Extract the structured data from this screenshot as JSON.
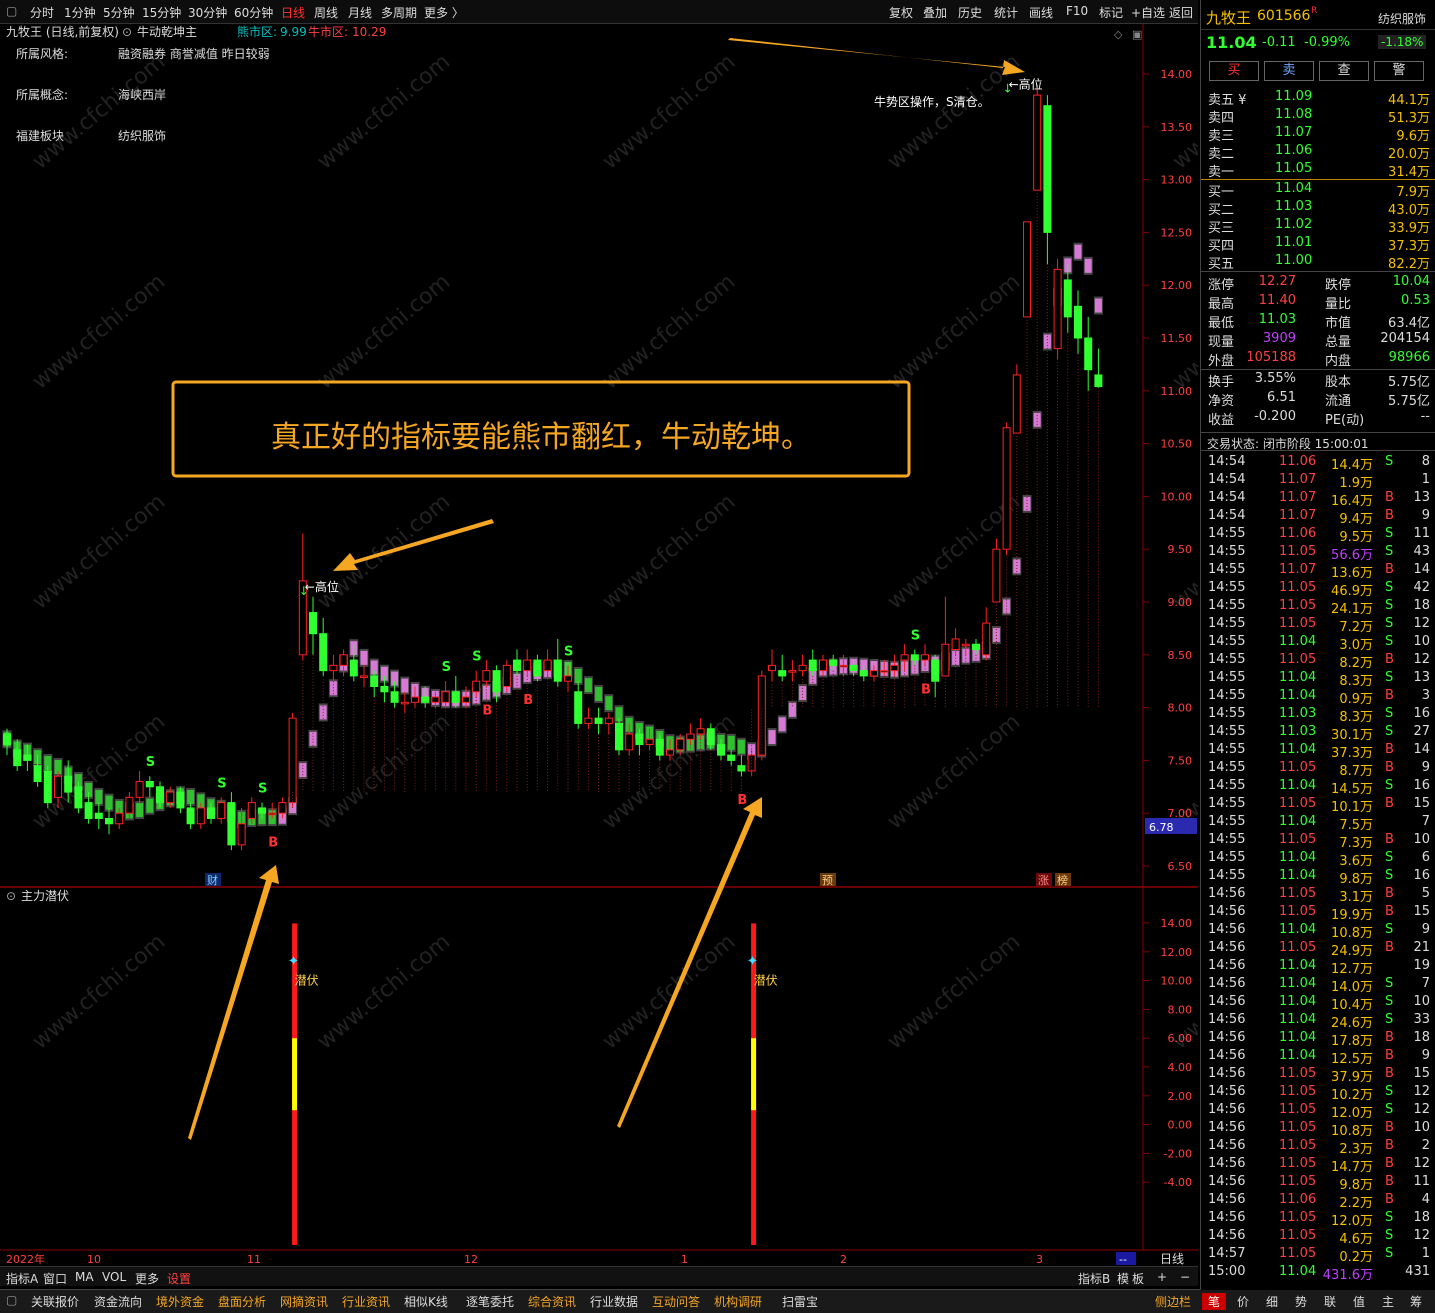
{
  "toolbar": {
    "items": [
      "分时",
      "1分钟",
      "5分钟",
      "15分钟",
      "30分钟",
      "60分钟",
      "日线",
      "周线",
      "月线",
      "多周期",
      "更多 〉"
    ],
    "right": [
      "复权",
      "叠加",
      "历史",
      "统计",
      "画线",
      "F10",
      "标记",
      "+自选",
      "返回"
    ]
  },
  "chart_header": {
    "title": "九牧王 (日线,前复权)",
    "indicator": "牛动乾坤主",
    "bear_label": "熊市区:",
    "bear_value": "9.99",
    "bull_label": "牛市区:",
    "bull_value": "10.29"
  },
  "info": [
    {
      "k": "所属风格:",
      "v": "融资融券 商誉减值 昨日较弱"
    },
    {
      "k": "所属概念:",
      "v": "海峡西岸"
    },
    {
      "k": "福建板块",
      "v": "纺织服饰"
    }
  ],
  "annotations": {
    "headline": "真正好的指标要能熊市翻红，牛动乾坤。",
    "note": "牛势区操作，S清仓。",
    "high": "←高位",
    "lurk": "潜伏",
    "current_price_tag": "6.78",
    "event_cai": "财",
    "event_yu": "预",
    "event_zhang": "涨",
    "event_bang": "榜"
  },
  "sub_panel_title": "主力潜伏",
  "x_axis": {
    "labels": [
      "2022年",
      "10",
      "11",
      "12",
      "1",
      "2",
      "3"
    ],
    "period": "日线",
    "dash": "--"
  },
  "bottom_bar1": [
    "指标A",
    "窗口",
    "MA",
    "VOL",
    "更多",
    "设置"
  ],
  "bottom_bar1_right": [
    "指标B",
    "模",
    "板",
    "+",
    "−"
  ],
  "bottom_bar2": [
    "关联报价",
    "资金流向",
    "境外资金",
    "盘面分析",
    "网摘资讯",
    "行业资讯",
    "相似K线",
    "逐笔委托",
    "综合资讯",
    "行业数据",
    "互动问答",
    "机构调研",
    "扫雷宝"
  ],
  "bottom_bar2_right": [
    "侧边栏",
    "笔",
    "价",
    "细",
    "势",
    "联",
    "值",
    "主",
    "筹"
  ],
  "quote": {
    "name": "九牧王",
    "code": "601566",
    "r_badge": "R",
    "sector": "纺织服饰",
    "price": "11.04",
    "change": "-0.11",
    "pct": "-0.99%",
    "sector_pct": "-1.18%",
    "buttons": [
      "买",
      "卖",
      "查",
      "警"
    ]
  },
  "orderbook": {
    "sell": [
      {
        "l": "卖五 ¥",
        "p": "11.09",
        "v": "44.1万"
      },
      {
        "l": "卖四",
        "p": "11.08",
        "v": "51.3万"
      },
      {
        "l": "卖三",
        "p": "11.07",
        "v": "9.6万"
      },
      {
        "l": "卖二",
        "p": "11.06",
        "v": "20.0万"
      },
      {
        "l": "卖一",
        "p": "11.05",
        "v": "31.4万"
      }
    ],
    "buy": [
      {
        "l": "买一",
        "p": "11.04",
        "v": "7.9万"
      },
      {
        "l": "买二",
        "p": "11.03",
        "v": "43.0万"
      },
      {
        "l": "买三",
        "p": "11.02",
        "v": "33.9万"
      },
      {
        "l": "买四",
        "p": "11.01",
        "v": "37.3万"
      },
      {
        "l": "买五",
        "p": "11.00",
        "v": "82.2万"
      }
    ]
  },
  "stats": [
    [
      "涨停",
      "12.27",
      "跌停",
      "10.04"
    ],
    [
      "最高",
      "11.40",
      "量比",
      "0.53"
    ],
    [
      "最低",
      "11.03",
      "市值",
      "63.4亿"
    ],
    [
      "现量",
      "3909",
      "总量",
      "204154"
    ],
    [
      "外盘",
      "105188",
      "内盘",
      "98966"
    ],
    [
      "换手",
      "3.55%",
      "股本",
      "5.75亿"
    ],
    [
      "净资",
      "6.51",
      "流通",
      "5.75亿"
    ],
    [
      "收益",
      "-0.200",
      "PE(动)",
      "--"
    ]
  ],
  "trade_status": "交易状态: 闭市阶段 15:00:01",
  "ticks": [
    [
      "14:54",
      "11.06",
      "14.4万",
      "S",
      "8"
    ],
    [
      "14:54",
      "11.07",
      "1.9万",
      "",
      "1"
    ],
    [
      "14:54",
      "11.07",
      "16.4万",
      "B",
      "13"
    ],
    [
      "14:54",
      "11.07",
      "9.4万",
      "B",
      "9"
    ],
    [
      "14:55",
      "11.06",
      "9.5万",
      "S",
      "11"
    ],
    [
      "14:55",
      "11.05",
      "56.6万",
      "S",
      "43"
    ],
    [
      "14:55",
      "11.07",
      "13.6万",
      "B",
      "14"
    ],
    [
      "14:55",
      "11.05",
      "46.9万",
      "S",
      "42"
    ],
    [
      "14:55",
      "11.05",
      "24.1万",
      "S",
      "18"
    ],
    [
      "14:55",
      "11.05",
      "7.2万",
      "S",
      "12"
    ],
    [
      "14:55",
      "11.04",
      "3.0万",
      "S",
      "10"
    ],
    [
      "14:55",
      "11.05",
      "8.2万",
      "B",
      "12"
    ],
    [
      "14:55",
      "11.04",
      "8.3万",
      "S",
      "13"
    ],
    [
      "14:55",
      "11.04",
      "0.9万",
      "B",
      "3"
    ],
    [
      "14:55",
      "11.03",
      "8.3万",
      "S",
      "16"
    ],
    [
      "14:55",
      "11.03",
      "30.1万",
      "S",
      "27"
    ],
    [
      "14:55",
      "11.04",
      "37.3万",
      "B",
      "14"
    ],
    [
      "14:55",
      "11.05",
      "8.7万",
      "B",
      "9"
    ],
    [
      "14:55",
      "11.04",
      "14.5万",
      "S",
      "16"
    ],
    [
      "14:55",
      "11.05",
      "10.1万",
      "B",
      "15"
    ],
    [
      "14:55",
      "11.04",
      "7.5万",
      "",
      "7"
    ],
    [
      "14:55",
      "11.05",
      "7.3万",
      "B",
      "10"
    ],
    [
      "14:55",
      "11.04",
      "3.6万",
      "S",
      "6"
    ],
    [
      "14:55",
      "11.04",
      "9.8万",
      "S",
      "16"
    ],
    [
      "14:56",
      "11.05",
      "3.1万",
      "B",
      "5"
    ],
    [
      "14:56",
      "11.05",
      "19.9万",
      "B",
      "15"
    ],
    [
      "14:56",
      "11.04",
      "10.8万",
      "S",
      "9"
    ],
    [
      "14:56",
      "11.05",
      "24.9万",
      "B",
      "21"
    ],
    [
      "14:56",
      "11.04",
      "12.7万",
      "",
      "19"
    ],
    [
      "14:56",
      "11.04",
      "14.0万",
      "S",
      "7"
    ],
    [
      "14:56",
      "11.04",
      "10.4万",
      "S",
      "10"
    ],
    [
      "14:56",
      "11.04",
      "24.6万",
      "S",
      "33"
    ],
    [
      "14:56",
      "11.04",
      "17.8万",
      "B",
      "18"
    ],
    [
      "14:56",
      "11.04",
      "12.5万",
      "B",
      "9"
    ],
    [
      "14:56",
      "11.05",
      "37.9万",
      "B",
      "15"
    ],
    [
      "14:56",
      "11.05",
      "10.2万",
      "S",
      "12"
    ],
    [
      "14:56",
      "11.05",
      "12.0万",
      "S",
      "12"
    ],
    [
      "14:56",
      "11.05",
      "10.8万",
      "B",
      "10"
    ],
    [
      "14:56",
      "11.05",
      "2.3万",
      "B",
      "2"
    ],
    [
      "14:56",
      "11.05",
      "14.7万",
      "B",
      "12"
    ],
    [
      "14:56",
      "11.05",
      "9.8万",
      "B",
      "11"
    ],
    [
      "14:56",
      "11.06",
      "2.2万",
      "B",
      "4"
    ],
    [
      "14:56",
      "11.05",
      "12.0万",
      "S",
      "18"
    ],
    [
      "14:56",
      "11.05",
      "4.6万",
      "S",
      "12"
    ],
    [
      "14:57",
      "11.05",
      "0.2万",
      "S",
      "1"
    ],
    [
      "15:00",
      "11.04",
      "431.6万",
      "",
      "431"
    ]
  ],
  "chart_data": {
    "type": "candlestick",
    "y_ticks": [
      "14.00",
      "13.50",
      "13.00",
      "12.50",
      "12.00",
      "11.50",
      "11.00",
      "10.50",
      "10.00",
      "9.50",
      "9.00",
      "8.50",
      "8.00",
      "7.50",
      "7.00",
      "6.50"
    ],
    "ylim": [
      6.3,
      14.3
    ],
    "sub_y_ticks": [
      "14.00",
      "12.00",
      "10.00",
      "8.00",
      "6.00",
      "4.00",
      "2.00",
      "0.00",
      "-2.00",
      "-4.00"
    ],
    "sub_ylim": [
      -6.0,
      15.0
    ],
    "high_marks": [
      {
        "i": 29,
        "price": 9.14
      },
      {
        "i": 98,
        "price": 13.9
      }
    ],
    "signals": [
      {
        "i": 14,
        "t": "S"
      },
      {
        "i": 21,
        "t": "S"
      },
      {
        "i": 25,
        "t": "S"
      },
      {
        "i": 26,
        "t": "B"
      },
      {
        "i": 43,
        "t": "S"
      },
      {
        "i": 46,
        "t": "S"
      },
      {
        "i": 47,
        "t": "B"
      },
      {
        "i": 51,
        "t": "B"
      },
      {
        "i": 55,
        "t": "S"
      },
      {
        "i": 72,
        "t": "B"
      },
      {
        "i": 89,
        "t": "S"
      },
      {
        "i": 90,
        "t": "B"
      }
    ],
    "lurk_signals": [
      {
        "i": 28,
        "value": 13.0
      },
      {
        "i": 73,
        "value": 13.0
      }
    ],
    "candles": [
      [
        7.75,
        7.65,
        7.8,
        7.55
      ],
      [
        7.6,
        7.45,
        7.7,
        7.4
      ],
      [
        7.55,
        7.5,
        7.65,
        7.4
      ],
      [
        7.45,
        7.3,
        7.55,
        7.25
      ],
      [
        7.4,
        7.1,
        7.45,
        7.05
      ],
      [
        7.15,
        7.35,
        7.4,
        7.05
      ],
      [
        7.35,
        7.2,
        7.5,
        7.1
      ],
      [
        7.25,
        7.05,
        7.3,
        7.0
      ],
      [
        7.1,
        6.95,
        7.2,
        6.9
      ],
      [
        7.0,
        6.95,
        7.1,
        6.85
      ],
      [
        6.95,
        6.9,
        7.05,
        6.8
      ],
      [
        6.9,
        7.0,
        7.05,
        6.85
      ],
      [
        7.0,
        7.15,
        7.2,
        6.95
      ],
      [
        7.15,
        7.3,
        7.4,
        7.1
      ],
      [
        7.3,
        7.25,
        7.35,
        7.15
      ],
      [
        7.25,
        7.1,
        7.3,
        7.05
      ],
      [
        7.1,
        7.2,
        7.25,
        7.05
      ],
      [
        7.2,
        7.05,
        7.25,
        7.0
      ],
      [
        7.05,
        6.9,
        7.1,
        6.85
      ],
      [
        6.9,
        7.05,
        7.1,
        6.85
      ],
      [
        7.05,
        6.95,
        7.1,
        6.9
      ],
      [
        6.95,
        7.1,
        7.15,
        6.9
      ],
      [
        7.1,
        6.7,
        7.2,
        6.65
      ],
      [
        6.7,
        6.9,
        7.05,
        6.65
      ],
      [
        6.95,
        7.1,
        7.15,
        6.9
      ],
      [
        7.05,
        7.0,
        7.1,
        6.95
      ],
      [
        7.0,
        7.0,
        7.1,
        6.95
      ],
      [
        7.0,
        7.1,
        7.15,
        6.95
      ],
      [
        7.1,
        7.9,
        7.95,
        7.05
      ],
      [
        8.5,
        9.2,
        9.65,
        8.45
      ],
      [
        8.9,
        8.7,
        9.05,
        8.5
      ],
      [
        8.7,
        8.35,
        8.85,
        8.3
      ],
      [
        8.35,
        8.4,
        8.5,
        8.25
      ],
      [
        8.4,
        8.5,
        8.55,
        8.3
      ],
      [
        8.45,
        8.3,
        8.6,
        8.25
      ],
      [
        8.3,
        8.3,
        8.4,
        8.2
      ],
      [
        8.3,
        8.2,
        8.35,
        8.1
      ],
      [
        8.2,
        8.15,
        8.3,
        8.05
      ],
      [
        8.15,
        8.05,
        8.25,
        8.0
      ],
      [
        8.05,
        8.05,
        8.15,
        7.95
      ],
      [
        8.05,
        8.1,
        8.2,
        8.0
      ],
      [
        8.1,
        8.05,
        8.2,
        8.0
      ],
      [
        8.05,
        8.1,
        8.15,
        8.0
      ],
      [
        8.05,
        8.15,
        8.25,
        8.0
      ],
      [
        8.15,
        8.05,
        8.3,
        8.0
      ],
      [
        8.05,
        8.1,
        8.2,
        8.0
      ],
      [
        8.15,
        8.25,
        8.35,
        8.1
      ],
      [
        8.25,
        8.35,
        8.45,
        8.2
      ],
      [
        8.35,
        8.15,
        8.4,
        8.05
      ],
      [
        8.2,
        8.4,
        8.45,
        8.15
      ],
      [
        8.45,
        8.35,
        8.55,
        8.3
      ],
      [
        8.35,
        8.45,
        8.55,
        8.3
      ],
      [
        8.45,
        8.3,
        8.5,
        8.25
      ],
      [
        8.35,
        8.45,
        8.55,
        8.3
      ],
      [
        8.45,
        8.25,
        8.65,
        8.2
      ],
      [
        8.25,
        8.3,
        8.4,
        8.15
      ],
      [
        8.15,
        7.85,
        8.25,
        7.8
      ],
      [
        7.85,
        7.9,
        8.0,
        7.8
      ],
      [
        7.9,
        7.85,
        8.0,
        7.75
      ],
      [
        7.85,
        7.9,
        7.95,
        7.75
      ],
      [
        7.85,
        7.6,
        7.9,
        7.55
      ],
      [
        7.6,
        7.75,
        7.85,
        7.55
      ],
      [
        7.75,
        7.65,
        7.8,
        7.55
      ],
      [
        7.65,
        7.7,
        7.8,
        7.6
      ],
      [
        7.7,
        7.55,
        7.75,
        7.5
      ],
      [
        7.55,
        7.6,
        7.7,
        7.5
      ],
      [
        7.6,
        7.7,
        7.75,
        7.55
      ],
      [
        7.7,
        7.75,
        7.85,
        7.65
      ],
      [
        7.75,
        7.8,
        7.9,
        7.7
      ],
      [
        7.8,
        7.65,
        7.85,
        7.6
      ],
      [
        7.65,
        7.55,
        7.7,
        7.5
      ],
      [
        7.55,
        7.5,
        7.6,
        7.45
      ],
      [
        7.45,
        7.4,
        7.55,
        7.35
      ],
      [
        7.4,
        7.55,
        7.6,
        7.35
      ],
      [
        7.55,
        8.3,
        8.35,
        7.5
      ],
      [
        8.35,
        8.4,
        8.55,
        8.25
      ],
      [
        8.35,
        8.3,
        8.5,
        8.25
      ],
      [
        8.35,
        8.35,
        8.45,
        8.25
      ],
      [
        8.35,
        8.4,
        8.5,
        8.3
      ],
      [
        8.45,
        8.35,
        8.55,
        8.3
      ],
      [
        8.35,
        8.45,
        8.5,
        8.3
      ],
      [
        8.45,
        8.4,
        8.5,
        8.35
      ],
      [
        8.4,
        8.4,
        8.5,
        8.3
      ],
      [
        8.4,
        8.35,
        8.45,
        8.3
      ],
      [
        8.35,
        8.3,
        8.4,
        8.25
      ],
      [
        8.3,
        8.35,
        8.4,
        8.25
      ],
      [
        8.35,
        8.35,
        8.45,
        8.3
      ],
      [
        8.35,
        8.4,
        8.5,
        8.3
      ],
      [
        8.45,
        8.5,
        8.6,
        8.35
      ],
      [
        8.5,
        8.45,
        8.55,
        8.4
      ],
      [
        8.45,
        8.5,
        8.6,
        8.4
      ],
      [
        8.45,
        8.25,
        8.5,
        8.1
      ],
      [
        8.3,
        8.6,
        9.05,
        8.3
      ],
      [
        8.55,
        8.65,
        8.75,
        8.5
      ],
      [
        8.6,
        8.6,
        8.65,
        8.5
      ],
      [
        8.6,
        8.55,
        8.65,
        8.5
      ],
      [
        8.5,
        8.8,
        8.95,
        8.45
      ],
      [
        9.0,
        9.5,
        9.6,
        9.0
      ],
      [
        9.5,
        10.65,
        10.7,
        9.45
      ],
      [
        10.6,
        11.15,
        11.25,
        10.6
      ],
      [
        11.7,
        12.6,
        12.6,
        11.7
      ],
      [
        12.9,
        13.8,
        13.9,
        12.9
      ],
      [
        13.7,
        12.5,
        13.8,
        12.2
      ],
      [
        11.4,
        12.15,
        12.25,
        11.3
      ],
      [
        12.05,
        11.7,
        12.2,
        11.55
      ],
      [
        11.8,
        11.5,
        11.95,
        11.35
      ],
      [
        11.5,
        11.2,
        11.7,
        11.0
      ],
      [
        11.15,
        11.04,
        11.4,
        11.03
      ]
    ]
  }
}
